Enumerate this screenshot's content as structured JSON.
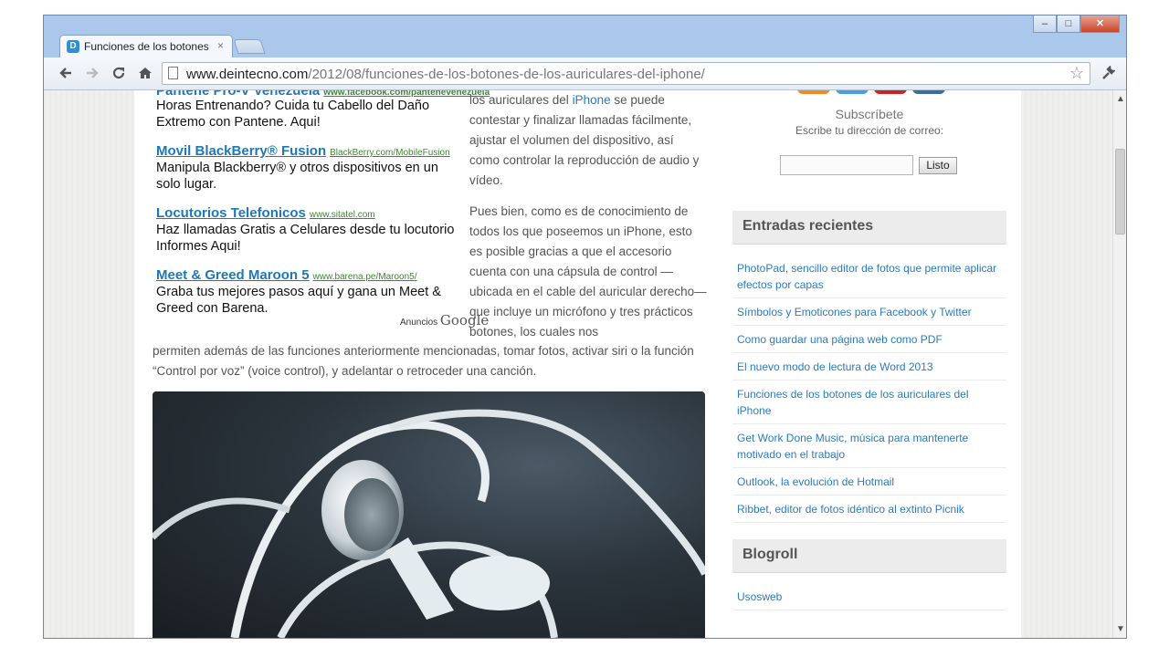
{
  "browser": {
    "tab_title": "Funciones de los botones c",
    "tab_close": "×",
    "url_host": "www.deintecno.com",
    "url_path": "/2012/08/funciones-de-los-botones-de-los-auriculares-del-iphone/",
    "icons": [
      "back-icon",
      "forward-icon",
      "reload-icon",
      "home-icon",
      "star-icon",
      "wrench-icon"
    ]
  },
  "window_controls": {
    "minimize": "–",
    "maximize": "□",
    "close": "✕"
  },
  "ads": {
    "top_partial": {
      "title": "Pantene Pro-V Venezuela",
      "url": "www.facebook.com/pantenevenezuela"
    },
    "items": [
      {
        "title": "",
        "url": "",
        "text": "Horas Entrenando? Cuida tu Cabello del Daño Extremo con Pantene. Aqui!"
      },
      {
        "title": "Movil BlackBerry® Fusion",
        "url": "BlackBerry.com/MobileFusion",
        "text": "Manipula Blackberry® y otros dispositivos en un solo lugar."
      },
      {
        "title": "Locutorios Telefonicos",
        "url": "www.sitatel.com",
        "text": "Haz llamadas Gratis a Celulares desde tu locutorio Informes Aqui!"
      },
      {
        "title": "Meet & Greed Maroon 5",
        "url": "www.barena.pe/Maroon5/",
        "text": "Graba tus mejores pasos aquí y gana un Meet & Greed con Barena."
      }
    ],
    "by_label": "Anuncios",
    "by_brand": "Google"
  },
  "article": {
    "p1_before": "los auriculares del ",
    "p1_link": "iPhone",
    "p1_after": " se puede contestar y finalizar llamadas fácilmente, ajustar el volumen del dispositivo, así como controlar la reproducción de audio y vídeo.",
    "p2": "Pues bien, como es de conocimiento de todos los que poseemos un iPhone, esto es posible gracias a que el accesorio cuenta con una cápsula de control — ubicada en el cable del auricular derecho— que incluye un micrófono y tres prácticos botones, los cuales nos",
    "p2_cont": "permiten además de las funciones anteriormente mencionadas, tomar fotos, activar siri o la función “Control por voz” (voice control), y adelantar o retroceder una canción."
  },
  "sidebar": {
    "subscribe_title": "Subscríbete",
    "subscribe_help": "Escribe tu dirección de correo:",
    "subscribe_value": "",
    "subscribe_button": "Listo",
    "social_colors": [
      "#f08a24",
      "#4a9ede",
      "#cc2127",
      "#3b6a9e"
    ],
    "recent_title": "Entradas recientes",
    "recent": [
      "PhotoPad, sencillo editor de fotos que permite aplicar efectos por capas",
      "Símbolos y Emoticones para Facebook y Twitter",
      "Como guardar una página web como PDF",
      "El nuevo modo de lectura de Word 2013",
      "Funciones de los botones de los auriculares del iPhone",
      "Get Work Done Music, música para mantenerte motivado en el trabajo",
      "Outlook, la evolución de Hotmail",
      "Ribbet, editor de fotos idéntico al extinto Picnik"
    ],
    "blogroll_title": "Blogroll",
    "blogroll": [
      "Usosweb"
    ]
  }
}
